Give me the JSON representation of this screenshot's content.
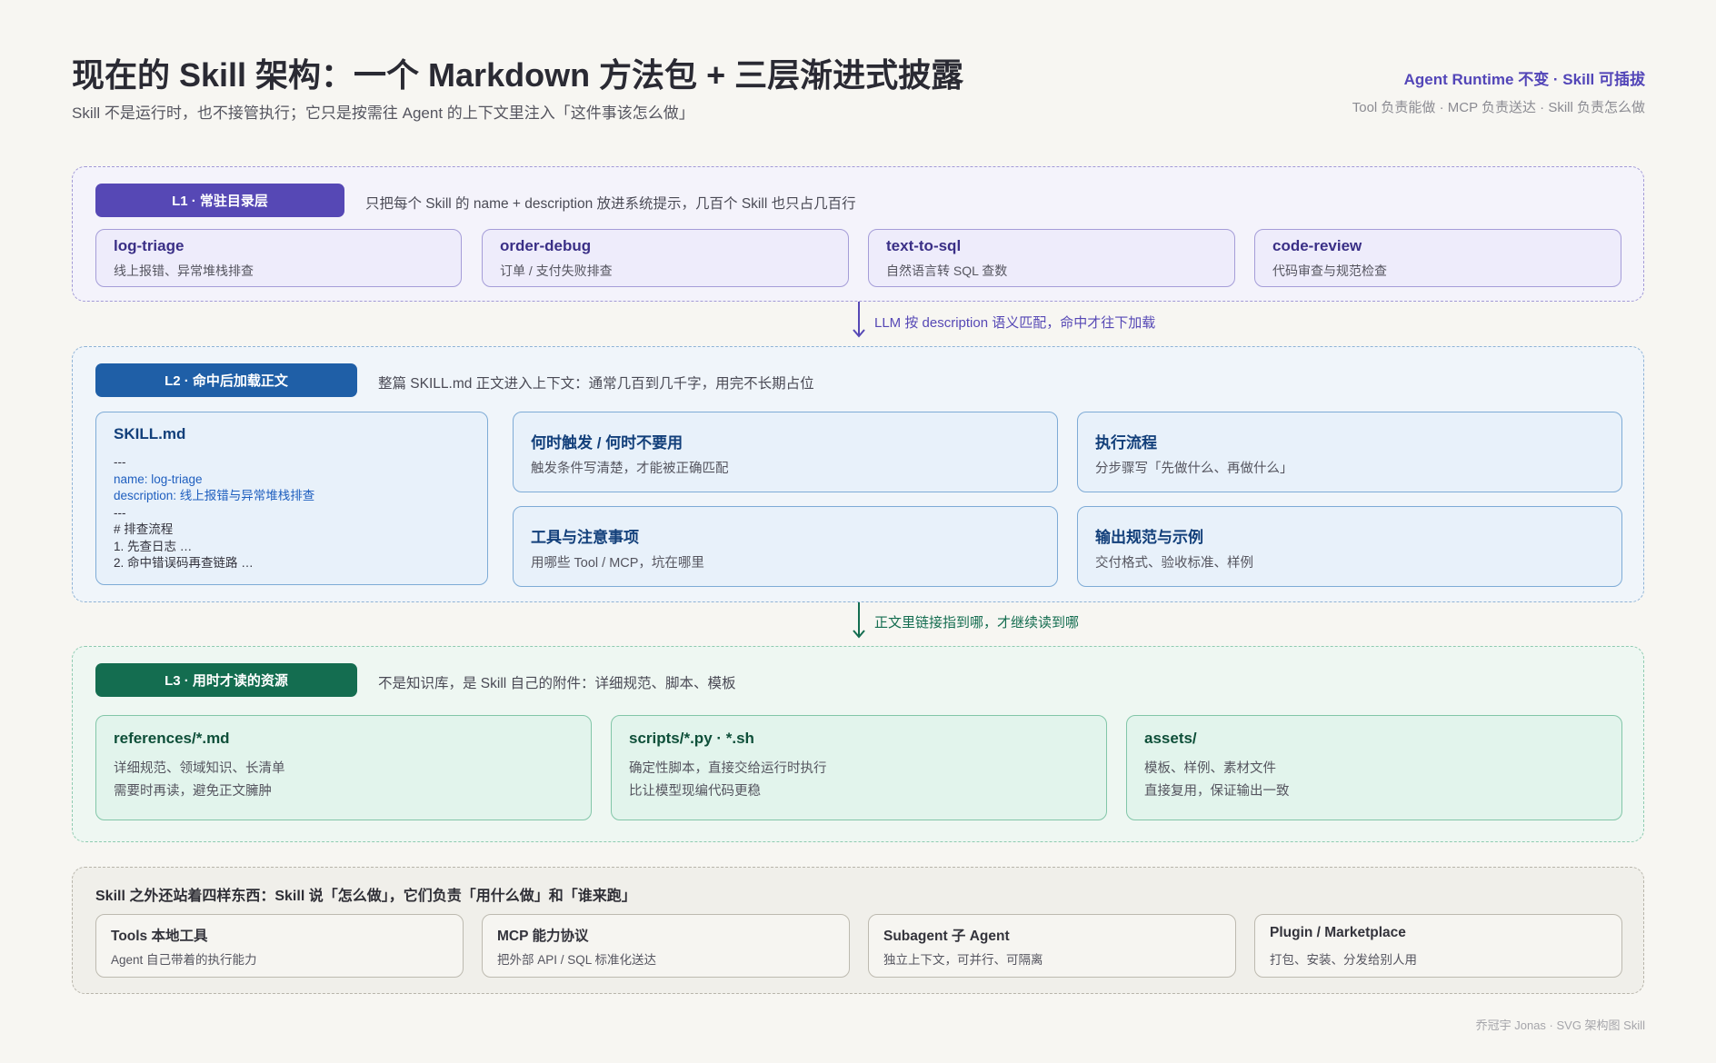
{
  "header": {
    "title": "现在的 Skill 架构：一个 Markdown 方法包 + 三层渐进式披露",
    "subtitle": "Skill 不是运行时，也不接管执行；它只是按需往 Agent 的上下文里注入「这件事该怎么做」",
    "tagline": "Agent Runtime 不变 · Skill 可插拔",
    "roles": "Tool 负责能做 · MCP 负责送达 · Skill 负责怎么做"
  },
  "l1": {
    "label": "L1 · 常驻目录层",
    "desc": "只把每个 Skill 的 name + description 放进系统提示，几百个 Skill 也只占几百行",
    "cards": [
      {
        "title": "log-triage",
        "sub": "线上报错、异常堆栈排查"
      },
      {
        "title": "order-debug",
        "sub": "订单 / 支付失败排查"
      },
      {
        "title": "text-to-sql",
        "sub": "自然语言转 SQL 查数"
      },
      {
        "title": "code-review",
        "sub": "代码审查与规范检查"
      }
    ]
  },
  "arrow1": "LLM 按 description 语义匹配，命中才往下加载",
  "l2": {
    "label": "L2 · 命中后加载正文",
    "desc": "整篇 SKILL.md 正文进入上下文：通常几百到几千字，用完不长期占位",
    "skillmd": {
      "title": "SKILL.md",
      "sep1": "---",
      "name_line": "name: log-triage",
      "desc_line": "description: 线上报错与异常堆栈排查",
      "sep2": "---",
      "h1": "# 排查流程",
      "step1": "1. 先查日志 …",
      "step2": "2. 命中错误码再查链路 …"
    },
    "cards": [
      {
        "title": "何时触发 / 何时不要用",
        "sub": "触发条件写清楚，才能被正确匹配"
      },
      {
        "title": "执行流程",
        "sub": "分步骤写「先做什么、再做什么」"
      },
      {
        "title": "工具与注意事项",
        "sub": "用哪些 Tool / MCP，坑在哪里"
      },
      {
        "title": "输出规范与示例",
        "sub": "交付格式、验收标准、样例"
      }
    ]
  },
  "arrow2": "正文里链接指到哪，才继续读到哪",
  "l3": {
    "label": "L3 · 用时才读的资源",
    "desc": "不是知识库，是 Skill 自己的附件：详细规范、脚本、模板",
    "cards": [
      {
        "title": "references/*.md",
        "line1": "详细规范、领域知识、长清单",
        "line2": "需要时再读，避免正文臃肿"
      },
      {
        "title": "scripts/*.py · *.sh",
        "line1": "确定性脚本，直接交给运行时执行",
        "line2": "比让模型现编代码更稳"
      },
      {
        "title": "assets/",
        "line1": "模板、样例、素材文件",
        "line2": "直接复用，保证输出一致"
      }
    ]
  },
  "l4": {
    "heading": "Skill 之外还站着四样东西：Skill 说「怎么做」，它们负责「用什么做」和「谁来跑」",
    "cards": [
      {
        "title": "Tools 本地工具",
        "sub": "Agent 自己带着的执行能力"
      },
      {
        "title": "MCP 能力协议",
        "sub": "把外部 API / SQL 标准化送达"
      },
      {
        "title": "Subagent 子 Agent",
        "sub": "独立上下文，可并行、可隔离"
      },
      {
        "title": "Plugin / Marketplace",
        "sub": "打包、安装、分发给别人用"
      }
    ]
  },
  "footer": "乔冠宇 Jonas · SVG 架构图 Skill",
  "colors": {
    "l1": "#5648b5",
    "l2": "#1f5fa7",
    "l3": "#146d50",
    "l1_title": "#3a2f86",
    "l2_title": "#123f7a",
    "l3_title": "#0e4f39"
  }
}
